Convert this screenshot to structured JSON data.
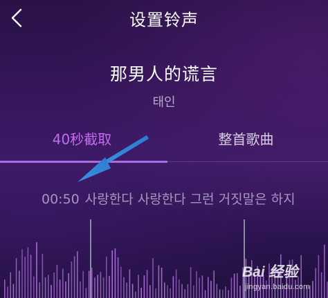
{
  "header": {
    "title": "设置铃声",
    "back_icon": "chevron-left-icon"
  },
  "song": {
    "title": "那男人的谎言",
    "artist": "태인"
  },
  "tabs": [
    {
      "label": "40秒截取",
      "active": true
    },
    {
      "label": "整首歌曲",
      "active": false
    }
  ],
  "lyric": {
    "time": "00:50",
    "text": "사랑한다 사랑한다 그런 거짓말은 하지"
  },
  "annotation": {
    "type": "arrow",
    "color": "#3b8fdc"
  },
  "colors": {
    "active_tab": "#c46cf0",
    "indicator": "#a86de0",
    "waveform": "#b977e6",
    "playhead": "#8f89a8"
  },
  "watermark": {
    "brand_text": "Bai 经验",
    "url": "jingyan.baidu.com"
  }
}
